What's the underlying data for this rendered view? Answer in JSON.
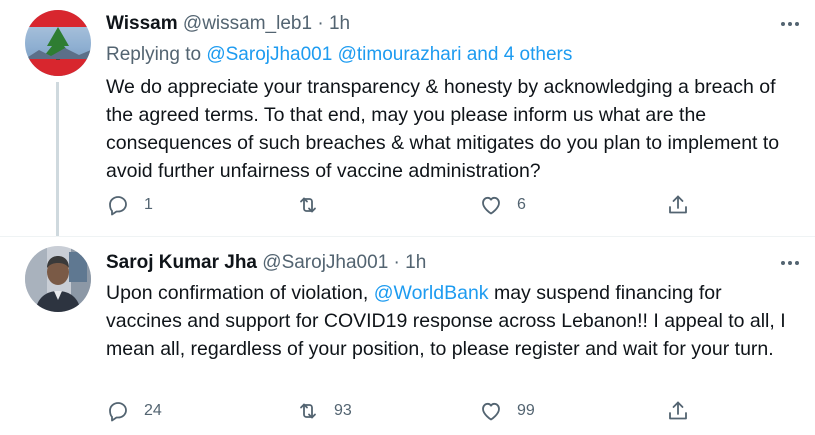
{
  "tweet1": {
    "name": "Wissam",
    "handle": "@wissam_leb1",
    "separator": "·",
    "time": "1h",
    "replying_prefix": "Replying to ",
    "replying_users": "@SarojJha001 @timourazhari",
    "replying_and": " and 4 others",
    "text": "We do appreciate your transparency & honesty by acknowledging a breach of the agreed terms. To that end, may you please inform us what are the consequences of such breaches & what mitigates do you plan to implement to avoid further unfairness of vaccine administration?",
    "reply_count": "1",
    "retweet_count": "",
    "like_count": "6"
  },
  "tweet2": {
    "name": "Saroj Kumar Jha",
    "handle": "@SarojJha001",
    "separator": "·",
    "time": "1h",
    "text_before": "Upon confirmation of violation, ",
    "mention": "@WorldBank",
    "text_after": " may suspend financing for vaccines and support for COVID19 response across Lebanon!! I appeal to all, I mean all, regardless of your position, to please register and wait for your turn.",
    "reply_count": "24",
    "retweet_count": "93",
    "like_count": "99"
  },
  "icons": {
    "reply": "reply-icon",
    "retweet": "retweet-icon",
    "like": "heart-icon",
    "share": "share-icon",
    "more": "more-dots-icon"
  },
  "colors": {
    "link": "#1d9bf0",
    "secondary_text": "#536471",
    "primary_text": "#0f1419",
    "thread_line": "#cfd9de"
  }
}
